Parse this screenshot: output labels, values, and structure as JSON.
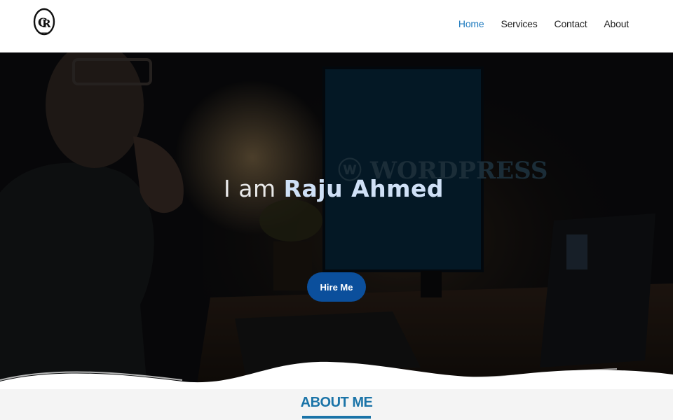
{
  "header": {
    "logo_icon": "cr-monogram-logo-icon",
    "nav": [
      {
        "label": "Home",
        "active": true
      },
      {
        "label": "Services",
        "active": false
      },
      {
        "label": "Contact",
        "active": false
      },
      {
        "label": "About",
        "active": false
      }
    ]
  },
  "hero": {
    "title_prefix": "I am ",
    "title_name": "Raju Ahmed",
    "button_label": "Hire Me",
    "background_image": "man-at-desk-with-wordpress-monitor-image"
  },
  "about": {
    "title": "ABOUT ME"
  },
  "colors": {
    "nav_active": "#1f7bbf",
    "button": "#0b4f9c",
    "accent": "#1b74a8"
  }
}
